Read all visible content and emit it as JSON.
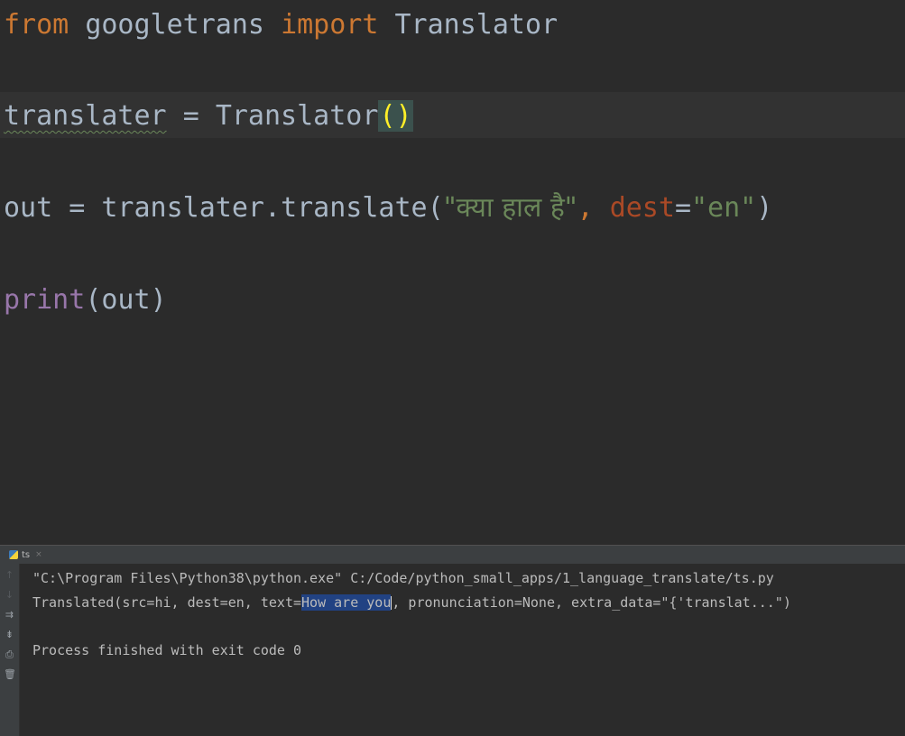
{
  "editor": {
    "lines": [
      {
        "from_kw": "from",
        "module": "googletrans",
        "import_kw": "import",
        "name": "Translator"
      },
      {
        "var": "translater",
        "eq": "=",
        "cls": "Translator",
        "parens": "()"
      },
      {
        "var": "out",
        "eq": "=",
        "obj": "translater",
        "dot": ".",
        "method": "translate",
        "open": "(",
        "arg_str": "\"क्या हाल है\"",
        "comma": ",",
        "kwarg": "dest",
        "kw_eq": "=",
        "kw_val": "\"en\"",
        "close": ")"
      },
      {
        "func": "print",
        "open": "(",
        "arg": "out",
        "close": ")"
      }
    ]
  },
  "run_window": {
    "tab_label": "ts",
    "tab_close": "×",
    "icons": [
      "up-arrow-icon",
      "down-arrow-icon",
      "soft-wrap-icon",
      "scroll-to-end-icon",
      "print-icon",
      "trash-icon"
    ],
    "console": {
      "command": "\"C:\\Program Files\\Python38\\python.exe\" C:/Code/python_small_apps/1_language_translate/ts.py",
      "result_prefix": "Translated(src=hi, dest=en, text=",
      "result_selected": "How are you",
      "result_suffix": ", pronunciation=None, extra_data=\"{'translat...\")",
      "exit_message": "Process finished with exit code 0"
    }
  },
  "colors": {
    "keyword": "#cc7832",
    "default": "#a9b7c6",
    "function": "#9876aa",
    "string": "#6a8759",
    "parameter": "#aa4926",
    "selection": "#214283",
    "background": "#2b2b2b"
  }
}
